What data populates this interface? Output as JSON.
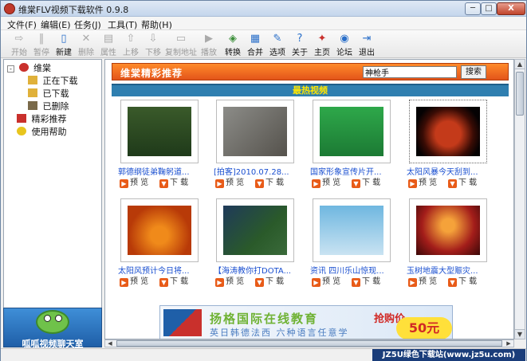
{
  "window": {
    "title": "维棠FLV视频下载软件 0.9.8",
    "min_label": "─",
    "max_label": "□",
    "close_label": "X"
  },
  "menu": [
    {
      "label": "文件(F)"
    },
    {
      "label": "编辑(E)"
    },
    {
      "label": "任务(J)"
    },
    {
      "label": "工具(T)"
    },
    {
      "label": "帮助(H)"
    }
  ],
  "toolbar": [
    {
      "label": "开始",
      "icon": "play-arrow-icon",
      "glyph": "⇨",
      "enabled": false
    },
    {
      "label": "暂停",
      "icon": "pause-icon",
      "glyph": "‖",
      "enabled": false
    },
    {
      "label": "新建",
      "icon": "new-file-icon",
      "glyph": "▯",
      "enabled": true,
      "color": "#2a6fc9"
    },
    {
      "label": "删除",
      "icon": "delete-icon",
      "glyph": "✕",
      "enabled": false
    },
    {
      "label": "属性",
      "icon": "properties-icon",
      "glyph": "▤",
      "enabled": false
    },
    {
      "label": "上移",
      "icon": "move-up-icon",
      "glyph": "⇧",
      "enabled": false
    },
    {
      "label": "下移",
      "icon": "move-down-icon",
      "glyph": "⇩",
      "enabled": false
    },
    {
      "label": "复制地址",
      "icon": "copy-address-icon",
      "glyph": "▭",
      "enabled": false
    },
    {
      "label": "播放",
      "icon": "play-icon",
      "glyph": "▶",
      "enabled": false
    },
    {
      "label": "转换",
      "icon": "convert-icon",
      "glyph": "◈",
      "enabled": true,
      "color": "#3c8f3a"
    },
    {
      "label": "合并",
      "icon": "merge-icon",
      "glyph": "▦",
      "enabled": true,
      "color": "#2a6fc9"
    },
    {
      "label": "选项",
      "icon": "options-icon",
      "glyph": "✎",
      "enabled": true,
      "color": "#2a6fc9"
    },
    {
      "label": "关于",
      "icon": "about-icon",
      "glyph": "?",
      "enabled": true,
      "color": "#2a6fc9"
    },
    {
      "label": "主页",
      "icon": "homepage-icon",
      "glyph": "✦",
      "enabled": true,
      "color": "#c9302c"
    },
    {
      "label": "论坛",
      "icon": "forum-icon",
      "glyph": "◉",
      "enabled": true,
      "color": "#2a6fc9"
    },
    {
      "label": "退出",
      "icon": "exit-icon",
      "glyph": "⇥",
      "enabled": true,
      "color": "#2a6fc9"
    }
  ],
  "sidebar": {
    "root": {
      "label": "维棠",
      "icon": "weitang-logo-icon"
    },
    "items": [
      {
        "label": "正在下载",
        "icon": "downloading-folder-icon",
        "color": "#e0b13a"
      },
      {
        "label": "已下载",
        "icon": "downloaded-folder-icon",
        "color": "#e0b13a"
      },
      {
        "label": "已删除",
        "icon": "trash-icon",
        "color": "#7a6a4a"
      }
    ],
    "extra": [
      {
        "label": "精彩推荐",
        "icon": "recommend-icon",
        "color": "#c9302c"
      },
      {
        "label": "使用帮助",
        "icon": "help-bulb-icon",
        "color": "#e8c51e"
      }
    ]
  },
  "left_ad": {
    "text": "呱呱视频聊天室",
    "icon": "frog-mascot-icon"
  },
  "banner": {
    "title": "维棠精彩推荐",
    "search_value": "神枪手",
    "search_button": "搜索"
  },
  "hot": {
    "title": "最热视频"
  },
  "videos": [
    {
      "title": "郭德纲徒弟鞠躬道...",
      "preview": "预 览",
      "download": "下 载",
      "scene": "man-on-stage"
    },
    {
      "title": "[拍客]2010.07.28...",
      "preview": "预 览",
      "download": "下 载",
      "scene": "debris-rubble"
    },
    {
      "title": "国家形象宣传片开...",
      "preview": "预 览",
      "download": "下 载",
      "scene": "green-screen-people"
    },
    {
      "title": "太阳风暴今天刮到...",
      "preview": "预 览",
      "download": "下 载",
      "scene": "dark-sun"
    },
    {
      "title": "太阳风预计今日将...",
      "preview": "预 览",
      "download": "下 载",
      "scene": "orange-sun"
    },
    {
      "title": "【海涛教你打DOTA...",
      "preview": "预 览",
      "download": "下 载",
      "scene": "game-map"
    },
    {
      "title": "资讯 四川乐山惊现...",
      "preview": "预 览",
      "download": "下 载",
      "scene": "blue-sky"
    },
    {
      "title": "玉树地震大型赈灾...",
      "preview": "预 览",
      "download": "下 载",
      "scene": "red-stage"
    }
  ],
  "bottom_ad": {
    "line1": "扬格国际在线教育",
    "line2": "英日韩德法西 六种语言任意学",
    "badge": "抢购价",
    "price": "50元"
  },
  "status": {
    "watermark": "JZ5U绿色下载站(www.jz5u.com)"
  }
}
